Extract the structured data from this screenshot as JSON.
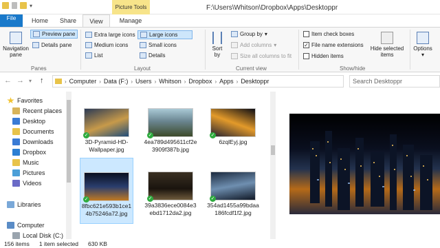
{
  "window": {
    "title": "F:\\Users\\Whitson\\Dropbox\\Apps\\Desktoppr",
    "context_tab": "Picture Tools"
  },
  "tabs": {
    "file": "File",
    "home": "Home",
    "share": "Share",
    "view": "View",
    "manage": "Manage"
  },
  "ribbon": {
    "panes": {
      "navigation_pane": "Navigation\npane",
      "preview_pane": "Preview pane",
      "details_pane": "Details pane",
      "label": "Panes"
    },
    "layout": {
      "extra_large": "Extra large icons",
      "large": "Large icons",
      "medium": "Medium icons",
      "small": "Small icons",
      "list": "List",
      "details": "Details",
      "label": "Layout"
    },
    "current_view": {
      "sort_by": "Sort\nby",
      "group_by": "Group by",
      "add_columns": "Add columns",
      "size_columns": "Size all columns to fit",
      "label": "Current view"
    },
    "show_hide": {
      "item_check_boxes": "Item check boxes",
      "file_name_extensions": "File name extensions",
      "hidden_items": "Hidden items",
      "hide_selected": "Hide selected\nitems",
      "label": "Show/hide"
    },
    "options": "Options"
  },
  "address": {
    "crumbs": [
      "Computer",
      "Data (F:)",
      "Users",
      "Whitson",
      "Dropbox",
      "Apps",
      "Desktoppr"
    ],
    "search_placeholder": "Search Desktoppr"
  },
  "nav": {
    "favorites": "Favorites",
    "recent_places": "Recent places",
    "desktop": "Desktop",
    "documents": "Documents",
    "downloads": "Downloads",
    "dropbox": "Dropbox",
    "music": "Music",
    "pictures": "Pictures",
    "videos": "Videos",
    "libraries": "Libraries",
    "computer": "Computer",
    "local_disk": "Local Disk (C:)"
  },
  "files": [
    {
      "name": "3D-Pyramid-HD-Wallpaper.jpg"
    },
    {
      "name": "4ea789d495611cf2e3909f387b.jpg"
    },
    {
      "name": "6zqlEyj.jpg"
    },
    {
      "name": "8fbc621e593b1ce14b75246a72.jpg"
    },
    {
      "name": "39a3836ece0084e3ebd1712da2.jpg"
    },
    {
      "name": "354ad1455a99bdaa186fcdf1f2.jpg"
    }
  ],
  "status": {
    "items": "156 items",
    "selected": "1 item selected",
    "size": "630 KB"
  },
  "colors": {
    "file_tab": "#1979ca",
    "context_tab": "#f7e48a",
    "selection": "#cce8ff"
  }
}
